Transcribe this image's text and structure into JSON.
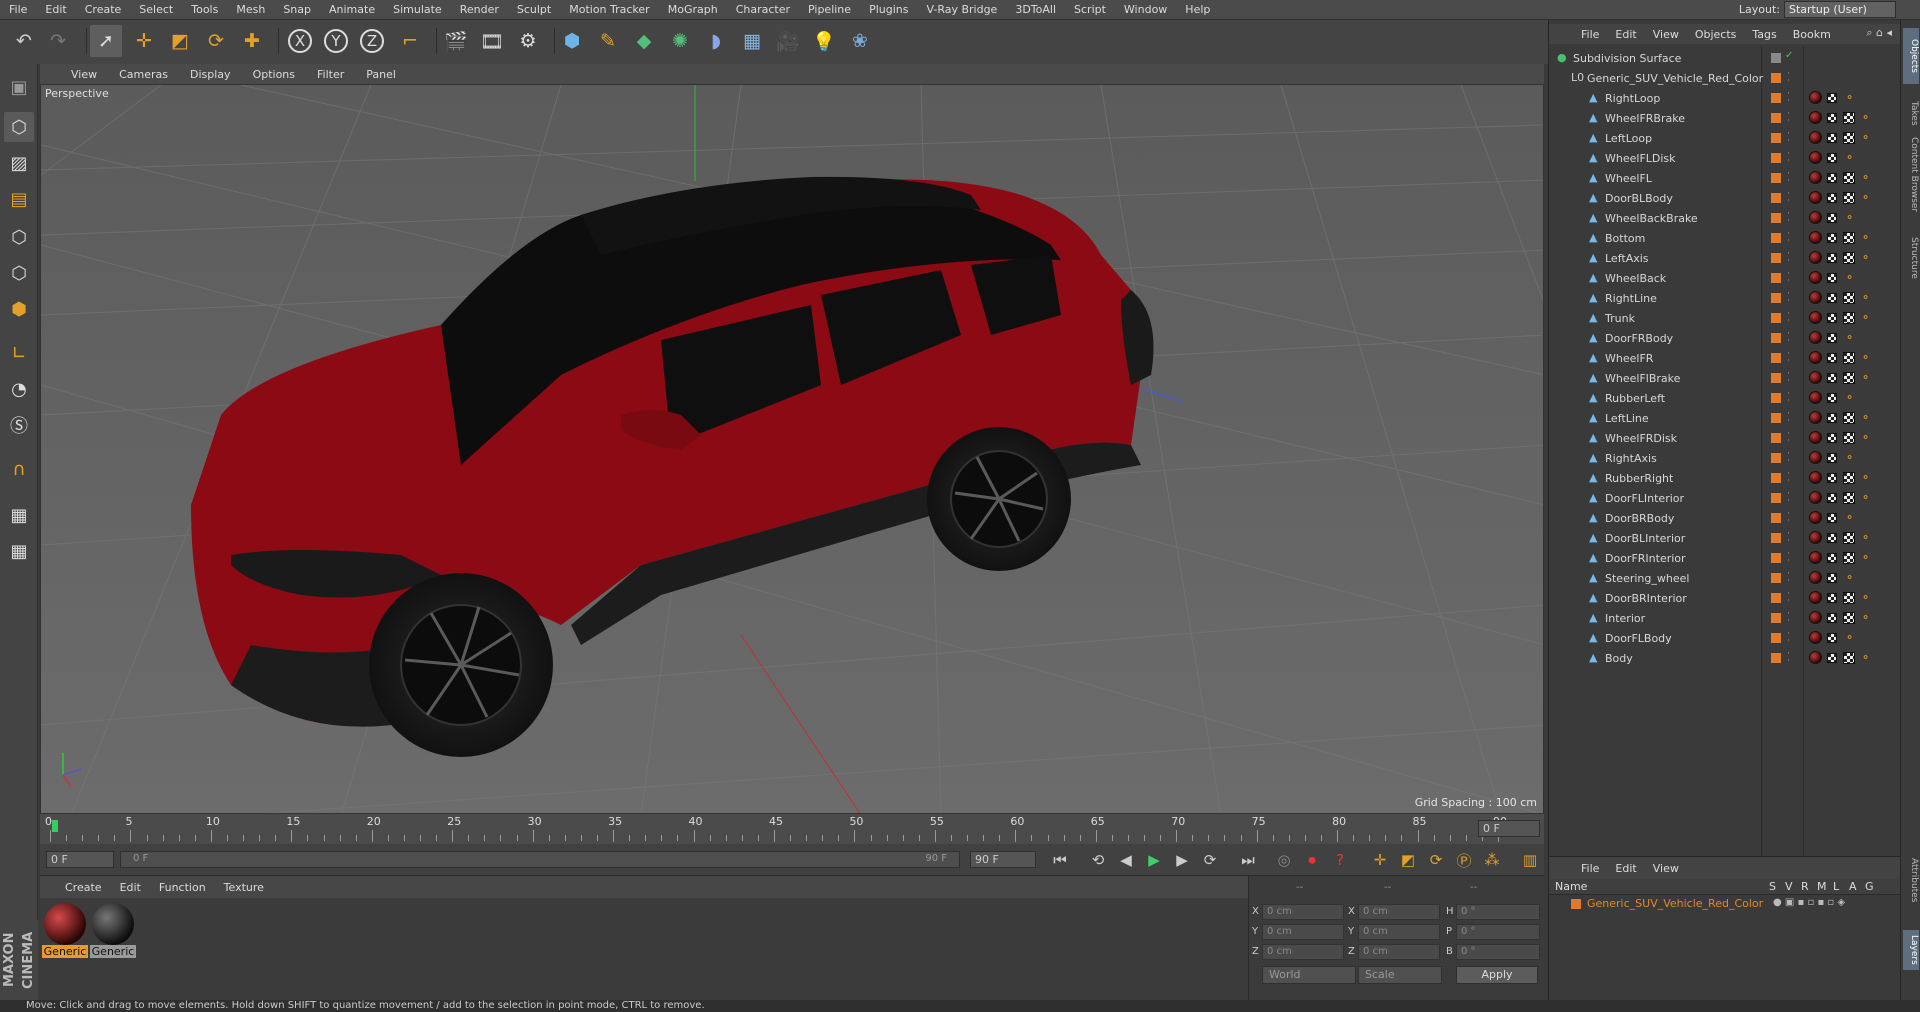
{
  "menubar": {
    "items": [
      "File",
      "Edit",
      "Create",
      "Select",
      "Tools",
      "Mesh",
      "Snap",
      "Animate",
      "Simulate",
      "Render",
      "Sculpt",
      "Motion Tracker",
      "MoGraph",
      "Character",
      "Pipeline",
      "Plugins",
      "V-Ray Bridge",
      "3DToAll",
      "Script",
      "Window",
      "Help"
    ],
    "layout_label": "Layout:",
    "layout_value": "Startup (User)"
  },
  "toolbar": {
    "icons": [
      "undo-icon",
      "redo-icon",
      "live-selection-icon",
      "move-icon",
      "scale-icon",
      "rotate-icon",
      "add-icon",
      "x-axis-icon",
      "y-axis-icon",
      "z-axis-icon",
      "coordinate-system-icon",
      "render-view-icon",
      "render-picture-viewer-icon",
      "edit-render-settings-icon",
      "cube-icon",
      "pen-icon",
      "subdivision-icon",
      "cloner-icon",
      "deformer-icon",
      "floor-icon",
      "camera-icon",
      "light-icon",
      "python-icon"
    ],
    "axis_x": "X",
    "axis_y": "Y",
    "axis_z": "Z"
  },
  "viewport": {
    "menu": [
      "View",
      "Cameras",
      "Display",
      "Options",
      "Filter",
      "Panel"
    ],
    "label": "Perspective",
    "grid_spacing": "Grid Spacing : 100 cm",
    "car_body_color": "#8c0a14",
    "car_dark_color": "#1c1c1c"
  },
  "timeline": {
    "ticks": [
      "0",
      "5",
      "10",
      "15",
      "20",
      "25",
      "30",
      "35",
      "40",
      "45",
      "50",
      "55",
      "60",
      "65",
      "70",
      "75",
      "80",
      "85",
      "90"
    ],
    "current_frame": "0 F",
    "start_field": "0 F",
    "range_start": "0 F",
    "range_end": "90 F",
    "end_field": "90 F"
  },
  "materials": {
    "menu": [
      "Create",
      "Edit",
      "Function",
      "Texture"
    ],
    "items": [
      {
        "label": "Generic",
        "color": "#8a1418"
      },
      {
        "label": "Generic",
        "color": "#2a2a2a"
      }
    ]
  },
  "coordinates": {
    "header": [
      "--",
      "--",
      "--"
    ],
    "rows": [
      {
        "a": "X",
        "av": "0 cm",
        "b": "X",
        "bv": "0 cm",
        "c": "H",
        "cv": "0 °"
      },
      {
        "a": "Y",
        "av": "0 cm",
        "b": "Y",
        "bv": "0 cm",
        "c": "P",
        "cv": "0 °"
      },
      {
        "a": "Z",
        "av": "0 cm",
        "b": "Z",
        "bv": "0 cm",
        "c": "B",
        "cv": "0 °"
      }
    ],
    "world": "World",
    "scale": "Scale",
    "apply": "Apply"
  },
  "objects": {
    "menu": [
      "File",
      "Edit",
      "View",
      "Objects",
      "Tags",
      "Bookm"
    ],
    "root": "Subdivision Surface",
    "group": "Generic_SUV_Vehicle_Red_Color",
    "children": [
      "RightLoop",
      "WheelFRBrake",
      "LeftLoop",
      "WheelFLDisk",
      "WheelFL",
      "DoorBLBody",
      "WheelBackBrake",
      "Bottom",
      "LeftAxis",
      "WheelBack",
      "RightLine",
      "Trunk",
      "DoorFRBody",
      "WheelFR",
      "WheelFlBrake",
      "RubberLeft",
      "LeftLine",
      "WheelFRDisk",
      "RightAxis",
      "RubberRight",
      "DoorFLInterior",
      "DoorBRBody",
      "DoorBLInterior",
      "DoorFRInterior",
      "Steering_wheel",
      "DoorBRInterior",
      "Interior",
      "DoorFLBody",
      "Body"
    ],
    "tag_color": "#e07a2c"
  },
  "layers": {
    "menu": [
      "File",
      "Edit",
      "View"
    ],
    "columns": [
      "Name",
      "S",
      "V",
      "R",
      "M",
      "L",
      "A",
      "G"
    ],
    "item": "Generic_SUV_Vehicle_Red_Color"
  },
  "side_tabs": [
    "Objects",
    "Takes",
    "Content Browser",
    "Structure",
    "Attributes",
    "Layers"
  ],
  "brand": "MAXON CINEMA 4D",
  "status": "Move: Click and drag to move elements. Hold down SHIFT to quantize movement / add to the selection in point mode, CTRL to remove."
}
